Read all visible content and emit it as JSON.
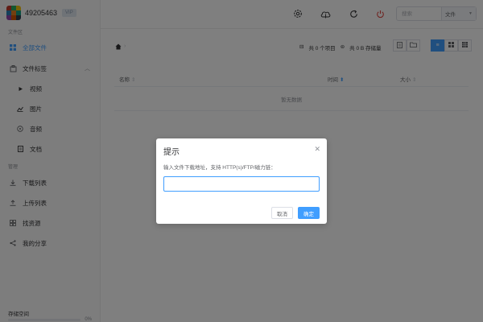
{
  "user": {
    "id": "49205463",
    "vip_badge": "VIP"
  },
  "sidebar": {
    "files_section": "文件区",
    "items": [
      {
        "label": "全部文件",
        "icon": "grid-icon",
        "active": true
      },
      {
        "label": "文件标签",
        "icon": "tag-icon",
        "chevron": "chevron-up-icon"
      },
      {
        "label": "视频",
        "icon": "play-icon"
      },
      {
        "label": "图片",
        "icon": "image-icon"
      },
      {
        "label": "音频",
        "icon": "audio-icon"
      },
      {
        "label": "文档",
        "icon": "document-icon"
      }
    ],
    "manage_section": "管理",
    "manage_items": [
      {
        "label": "下载列表",
        "icon": "download-icon"
      },
      {
        "label": "上传列表",
        "icon": "upload-icon"
      },
      {
        "label": "找资源",
        "icon": "apps-icon"
      },
      {
        "label": "我的分享",
        "icon": "share-icon"
      }
    ],
    "storage_label": "存储空间",
    "storage_percent": "0%"
  },
  "header": {
    "search_placeholder": "搜索",
    "search_type": "文件"
  },
  "toolbar": {
    "project_count": "共 0 个项目",
    "storage_used": "共 0 B 存储量"
  },
  "table": {
    "columns": [
      "名称",
      "时间",
      "大小"
    ],
    "empty_text": "暂无数据"
  },
  "dialog": {
    "title": "提示",
    "message": "输入文件下载地址，支持 HTTP(s)/FTP/磁力链：",
    "input_value": "",
    "cancel_label": "取消",
    "confirm_label": "确定"
  },
  "colors": {
    "accent": "#409eff",
    "mask": "rgba(0,0,0,0.5)"
  }
}
